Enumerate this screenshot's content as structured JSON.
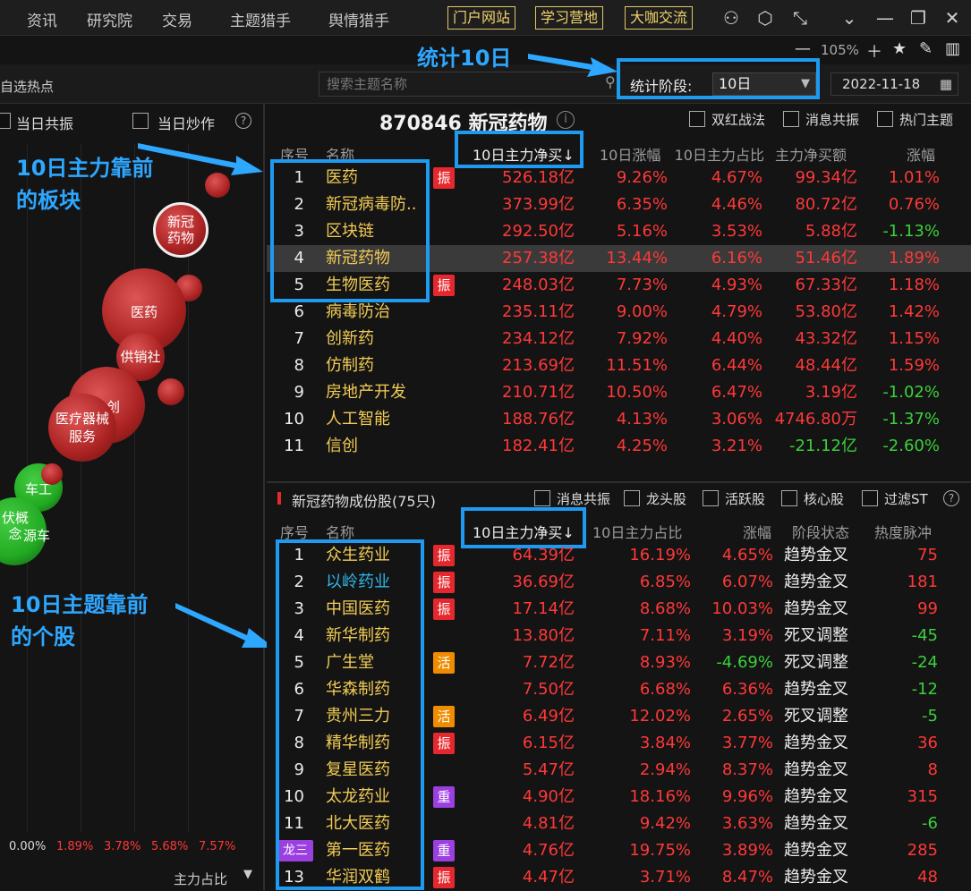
{
  "nav": {
    "items": [
      "资讯",
      "研究院",
      "交易",
      "主题猎手",
      "舆情猎手"
    ],
    "buttons": [
      "门户网站",
      "学习营地",
      "大咖交流"
    ]
  },
  "toolbar": {
    "zoom": "105%"
  },
  "search": {
    "placeholder": "搜索主题名称",
    "left_label": "自选热点"
  },
  "stat": {
    "label": "统计阶段:",
    "value": "10日",
    "date": "2022-11-18"
  },
  "annotations": {
    "stat": "统计10日",
    "sector_l1": "10日主力靠前",
    "sector_l2": "的板块",
    "stock_l1": "10日主题靠前",
    "stock_l2": "的个股"
  },
  "left": {
    "checks": [
      "当日共振",
      "当日炒作"
    ],
    "bubbles": [
      "新冠药物",
      "医药",
      "供销社",
      "信创",
      "医疗器械服务",
      "车工",
      "伏概念",
      "源车"
    ],
    "axis": [
      "0.00%",
      "1.89%",
      "3.78%",
      "5.68%",
      "7.57%"
    ],
    "axis_title": "主力占比"
  },
  "sector": {
    "title": "870846 新冠药物",
    "checks": [
      "双红战法",
      "消息共振",
      "热门主题"
    ],
    "headers": [
      "序号",
      "名称",
      "10日主力净买↓",
      "10日涨幅",
      "10日主力占比",
      "主力净买额",
      "涨幅"
    ],
    "rows": [
      {
        "no": "1",
        "name": "医药",
        "tag": "振",
        "buy": "526.18亿",
        "chg": "9.26%",
        "ratio": "4.67%",
        "net": "99.34亿",
        "pct": "1.01%"
      },
      {
        "no": "2",
        "name": "新冠病毒防..",
        "tag": "",
        "buy": "373.99亿",
        "chg": "6.35%",
        "ratio": "4.46%",
        "net": "80.72亿",
        "pct": "0.76%"
      },
      {
        "no": "3",
        "name": "区块链",
        "tag": "",
        "buy": "292.50亿",
        "chg": "5.16%",
        "ratio": "3.53%",
        "net": "5.88亿",
        "pct": "-1.13%"
      },
      {
        "no": "4",
        "name": "新冠药物",
        "tag": "",
        "buy": "257.38亿",
        "chg": "13.44%",
        "ratio": "6.16%",
        "net": "51.46亿",
        "pct": "1.89%"
      },
      {
        "no": "5",
        "name": "生物医药",
        "tag": "振",
        "buy": "248.03亿",
        "chg": "7.73%",
        "ratio": "4.93%",
        "net": "67.33亿",
        "pct": "1.18%"
      },
      {
        "no": "6",
        "name": "病毒防治",
        "tag": "",
        "buy": "235.11亿",
        "chg": "9.00%",
        "ratio": "4.79%",
        "net": "53.80亿",
        "pct": "1.42%"
      },
      {
        "no": "7",
        "name": "创新药",
        "tag": "",
        "buy": "234.12亿",
        "chg": "7.92%",
        "ratio": "4.40%",
        "net": "43.32亿",
        "pct": "1.15%"
      },
      {
        "no": "8",
        "name": "仿制药",
        "tag": "",
        "buy": "213.69亿",
        "chg": "11.51%",
        "ratio": "6.44%",
        "net": "48.44亿",
        "pct": "1.59%"
      },
      {
        "no": "9",
        "name": "房地产开发",
        "tag": "",
        "buy": "210.71亿",
        "chg": "10.50%",
        "ratio": "6.47%",
        "net": "3.19亿",
        "pct": "-1.02%"
      },
      {
        "no": "10",
        "name": "人工智能",
        "tag": "",
        "buy": "188.76亿",
        "chg": "4.13%",
        "ratio": "3.06%",
        "net": "4746.80万",
        "pct": "-1.37%"
      },
      {
        "no": "11",
        "name": "信创",
        "tag": "",
        "buy": "182.41亿",
        "chg": "4.25%",
        "ratio": "3.21%",
        "net": "-21.12亿",
        "pct": "-2.60%"
      }
    ]
  },
  "stocks": {
    "title": "新冠药物成份股(75只)",
    "checks": [
      "消息共振",
      "龙头股",
      "活跃股",
      "核心股",
      "过滤ST"
    ],
    "headers": [
      "序号",
      "名称",
      "10日主力净买↓",
      "10日主力占比",
      "涨幅",
      "阶段状态",
      "热度脉冲"
    ],
    "rows": [
      {
        "no": "1",
        "name": "众生药业",
        "tag": "振",
        "buy": "64.39亿",
        "ratio": "16.19%",
        "pct": "4.65%",
        "state": "趋势金叉",
        "heat": "75"
      },
      {
        "no": "2",
        "name": "以岭药业",
        "tag": "振",
        "buy": "36.69亿",
        "ratio": "6.85%",
        "pct": "6.07%",
        "state": "趋势金叉",
        "heat": "181"
      },
      {
        "no": "3",
        "name": "中国医药",
        "tag": "振",
        "buy": "17.14亿",
        "ratio": "8.68%",
        "pct": "10.03%",
        "state": "趋势金叉",
        "heat": "99"
      },
      {
        "no": "4",
        "name": "新华制药",
        "tag": "",
        "buy": "13.80亿",
        "ratio": "7.11%",
        "pct": "3.19%",
        "state": "死叉调整",
        "heat": "-45"
      },
      {
        "no": "5",
        "name": "广生堂",
        "tag": "活",
        "buy": "7.72亿",
        "ratio": "8.93%",
        "pct": "-4.69%",
        "state": "死叉调整",
        "heat": "-24"
      },
      {
        "no": "6",
        "name": "华森制药",
        "tag": "",
        "buy": "7.50亿",
        "ratio": "6.68%",
        "pct": "6.36%",
        "state": "趋势金叉",
        "heat": "-12"
      },
      {
        "no": "7",
        "name": "贵州三力",
        "tag": "活",
        "buy": "6.49亿",
        "ratio": "12.02%",
        "pct": "2.65%",
        "state": "死叉调整",
        "heat": "-5"
      },
      {
        "no": "8",
        "name": "精华制药",
        "tag": "振",
        "buy": "6.15亿",
        "ratio": "3.84%",
        "pct": "3.77%",
        "state": "趋势金叉",
        "heat": "36"
      },
      {
        "no": "9",
        "name": "复星医药",
        "tag": "",
        "buy": "5.47亿",
        "ratio": "2.94%",
        "pct": "8.37%",
        "state": "趋势金叉",
        "heat": "8"
      },
      {
        "no": "10",
        "name": "太龙药业",
        "tag": "重",
        "buy": "4.90亿",
        "ratio": "18.16%",
        "pct": "9.96%",
        "state": "趋势金叉",
        "heat": "315"
      },
      {
        "no": "11",
        "name": "北大医药",
        "tag": "",
        "buy": "4.81亿",
        "ratio": "9.42%",
        "pct": "3.63%",
        "state": "趋势金叉",
        "heat": "-6"
      },
      {
        "no": "龙三",
        "name": "第一医药",
        "tag": "重",
        "buy": "4.76亿",
        "ratio": "19.75%",
        "pct": "3.89%",
        "state": "趋势金叉",
        "heat": "285"
      },
      {
        "no": "13",
        "name": "华润双鹤",
        "tag": "振",
        "buy": "4.47亿",
        "ratio": "3.71%",
        "pct": "8.47%",
        "state": "趋势金叉",
        "heat": "48"
      }
    ]
  }
}
